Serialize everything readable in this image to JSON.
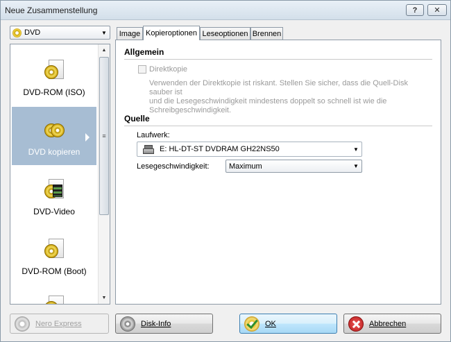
{
  "window": {
    "title": "Neue Zusammenstellung",
    "help_label": "?",
    "close_label": "✕"
  },
  "compilation_type": {
    "selected": "DVD"
  },
  "project_list": {
    "items": [
      {
        "label": "DVD-ROM (ISO)",
        "icon": "dvd-rom-iso-icon"
      },
      {
        "label": "DVD kopieren",
        "icon": "dvd-copy-icon",
        "selected": true
      },
      {
        "label": "DVD-Video",
        "icon": "dvd-video-icon"
      },
      {
        "label": "DVD-ROM (Boot)",
        "icon": "dvd-rom-boot-icon"
      }
    ]
  },
  "tabs": [
    {
      "label": "Image"
    },
    {
      "label": "Kopieroptionen",
      "active": true
    },
    {
      "label": "Leseoptionen"
    },
    {
      "label": "Brennen"
    }
  ],
  "general": {
    "title": "Allgemein",
    "direct_copy_label": "Direktkopie",
    "direct_copy_checked": false,
    "description_line1": "Verwenden der Direktkopie ist riskant. Stellen Sie sicher, dass die Quell-Disk sauber ist",
    "description_line2": "und die Lesegeschwindigkeit mindestens doppelt so schnell ist wie die",
    "description_line3": "Schreibgeschwindigkeit."
  },
  "source": {
    "title": "Quelle",
    "drive_label": "Laufwerk:",
    "drive_value": "E: HL-DT-ST DVDRAM GH22NS50",
    "speed_label": "Lesegeschwindigkeit:",
    "speed_value": "Maximum"
  },
  "buttons": {
    "nero_express": "Nero Express",
    "disk_info": "Disk-Info",
    "ok": "OK",
    "cancel": "Abbrechen"
  },
  "scrollbar": {
    "grip": "≡"
  }
}
